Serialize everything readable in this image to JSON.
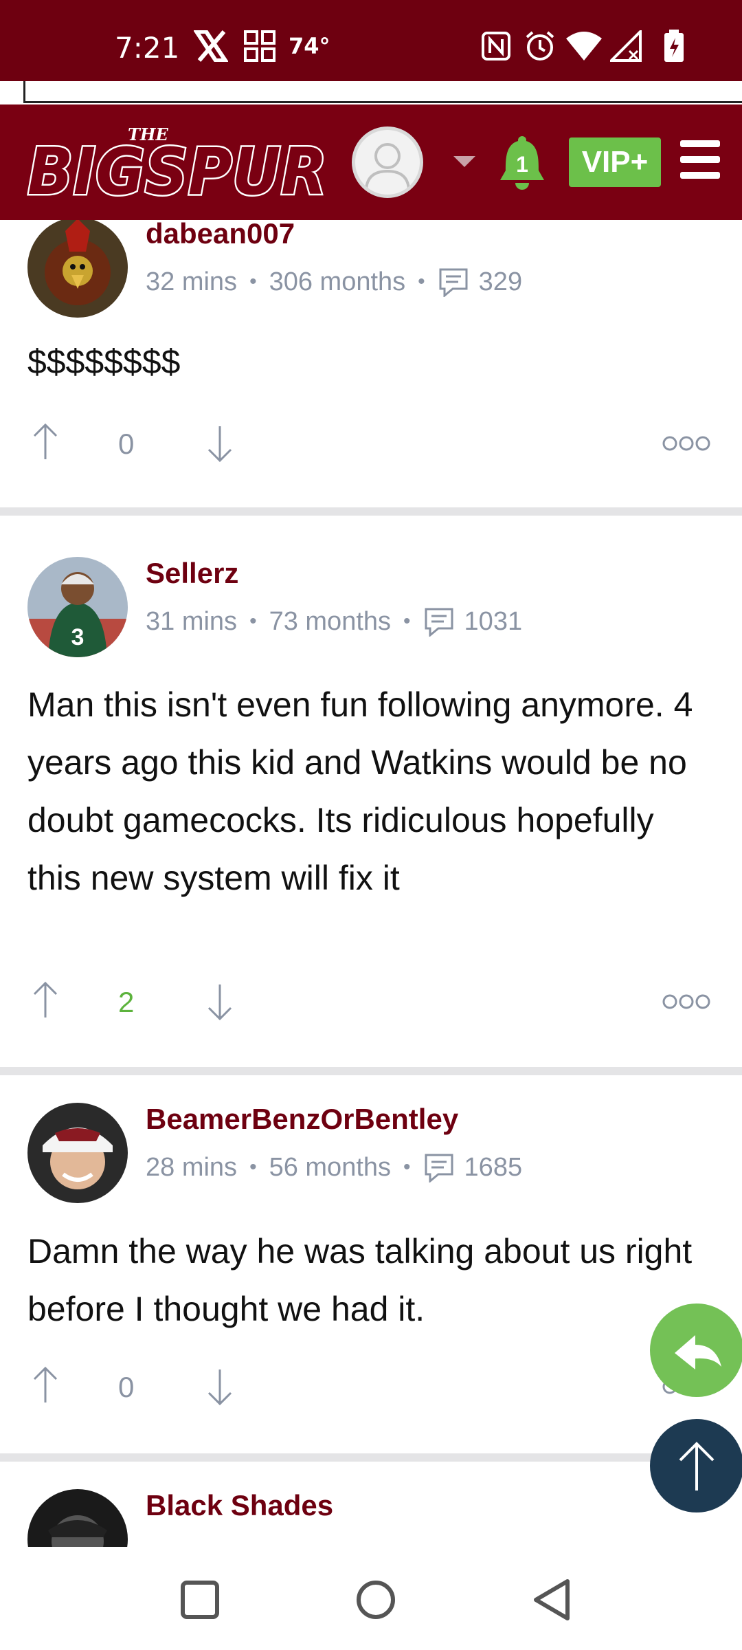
{
  "status_bar": {
    "time": "7:21",
    "weather": "74°",
    "icons": [
      "x-app-icon",
      "grid-app-icon",
      "nfc-icon",
      "alarm-icon",
      "wifi-icon",
      "signal-icon",
      "battery-charging-icon"
    ]
  },
  "header": {
    "logo_small": "THE",
    "logo_text": "BIGSPUR",
    "notification_count": "1",
    "vip_label": "VIP+",
    "colors": {
      "header_bg": "#7a0012",
      "status_bg": "#6e0010",
      "vip_bg": "#6cc04a",
      "bell": "#6cc04a"
    }
  },
  "comments": [
    {
      "username": "dabean007",
      "time_ago": "32 mins",
      "membership": "306 months",
      "post_count": "329",
      "body": "$$$$$$$$",
      "votes": "0"
    },
    {
      "username": "Sellerz",
      "time_ago": "31 mins",
      "membership": "73 months",
      "post_count": "1031",
      "body": "Man this isn't even fun following anymore. 4 years ago this kid and Watkins would be no doubt gamecocks. Its ridiculous hopefully this new system will fix it",
      "votes": "2"
    },
    {
      "username": "BeamerBenzOrBentley",
      "time_ago": "28 mins",
      "membership": "56 months",
      "post_count": "1685",
      "body": "Damn the way he was talking about us right before I thought we had it.",
      "votes": "0"
    },
    {
      "username": "Black Shades"
    }
  ],
  "floating": {
    "reply": "reply-icon",
    "scroll_top": "arrow-up-icon"
  },
  "nav": [
    "recents-button",
    "home-button",
    "back-button"
  ]
}
